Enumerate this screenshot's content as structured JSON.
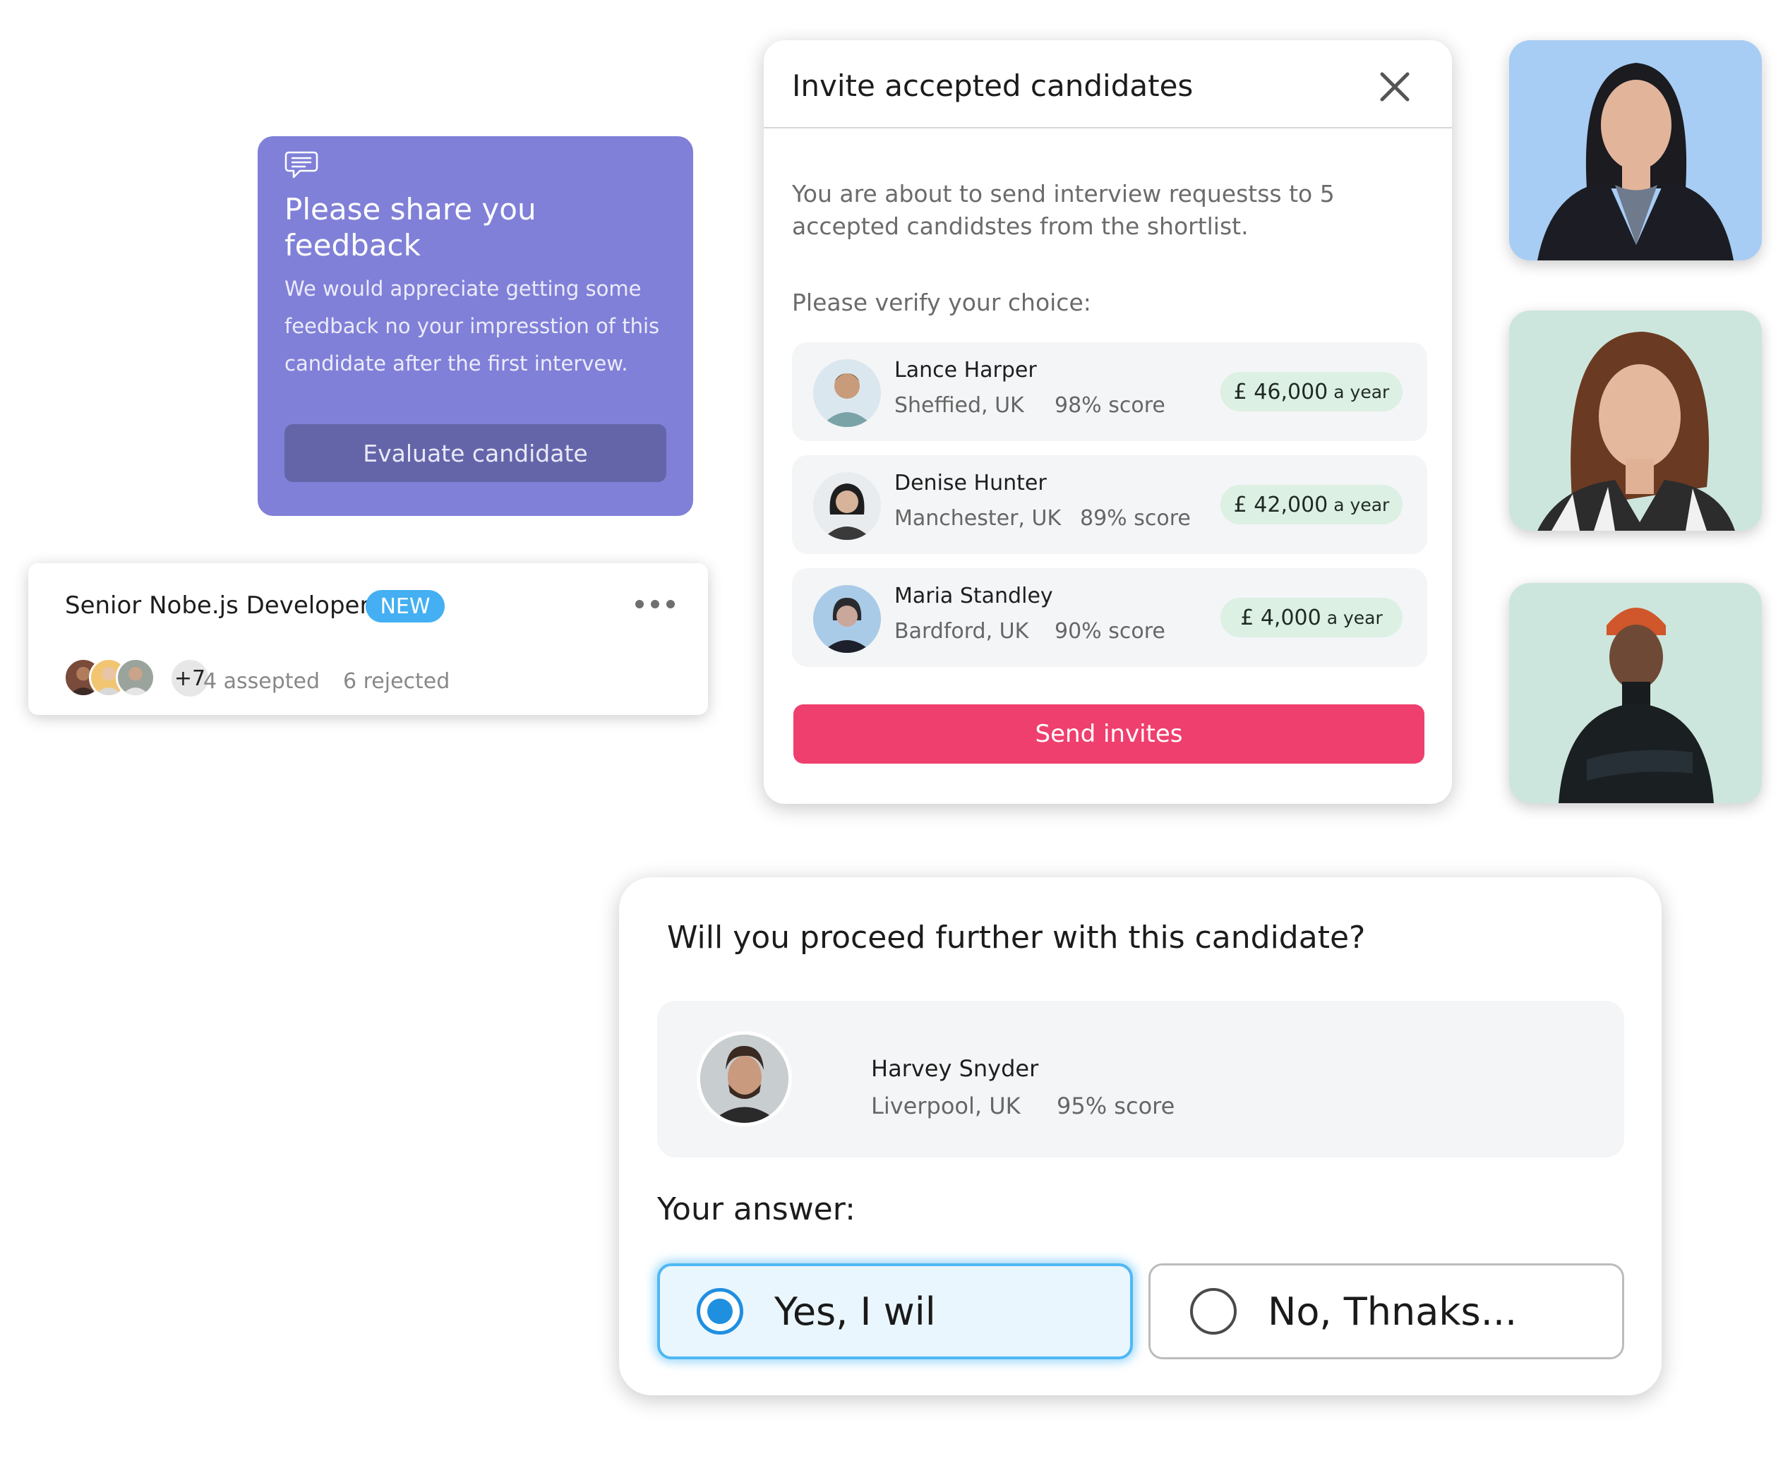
{
  "feedback_card": {
    "icon": "chat-bubble-icon",
    "title": "Please share you feedback",
    "body": "We would appreciate getting some feedback no your impresstion of this candidate after the first intervew.",
    "button_label": "Evaluate candidate",
    "background": "#8080d8"
  },
  "job_card": {
    "title": "Senior Nobe.js Developer",
    "badge": "NEW",
    "more_count": "+7",
    "accepted": "4 assepted",
    "rejected": "6 rejected"
  },
  "invite_modal": {
    "title": "Invite accepted candidates",
    "description": "You are about to send interview requestss to 5 accepted candidstes from the shortlist.",
    "verify_prompt": "Please verify your choice:",
    "candidates": [
      {
        "name": "Lance Harper",
        "location": "Sheffied, UK",
        "score": "98% score",
        "salary": "£ 46,000",
        "period": "a year"
      },
      {
        "name": "Denise Hunter",
        "location": "Manchester, UK",
        "score": "89% score",
        "salary": "£ 42,000",
        "period": "a year"
      },
      {
        "name": "Maria Standley",
        "location": "Bardford, UK",
        "score": "90% score",
        "salary": "£ 4,000",
        "period": "a year"
      }
    ],
    "send_label": "Send invites",
    "send_color": "#ef3f6e"
  },
  "proceed_card": {
    "question": "Will you proceed further with this candidate?",
    "candidate": {
      "name": "Harvey Snyder",
      "location": "Liverpool, UK",
      "score": "95% score"
    },
    "answer_label": "Your answer:",
    "options": [
      {
        "label": "Yes, I wil",
        "selected": true
      },
      {
        "label": "No, Thnaks...",
        "selected": false
      }
    ]
  }
}
